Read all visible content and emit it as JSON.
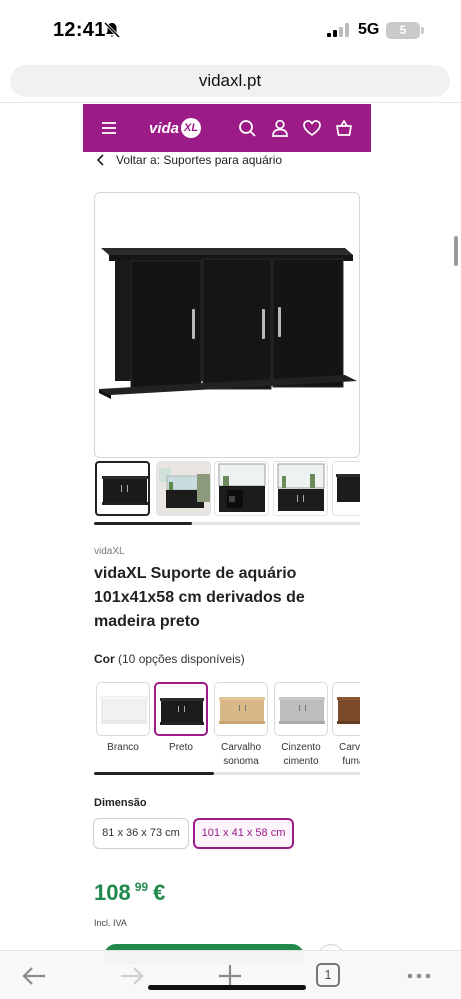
{
  "status_bar": {
    "time": "12:41",
    "network": "5G",
    "battery": "5"
  },
  "browser": {
    "url": "vidaxl.pt",
    "tab_count": "1"
  },
  "site_header": {
    "logo_text": "vida",
    "logo_badge": "XL",
    "background": "#9b1c86"
  },
  "breadcrumb": {
    "back_label": "Voltar a: Suportes para aquário"
  },
  "gallery": {
    "thumbnails": [
      "black-stand",
      "stand-with-aquarium-room",
      "stand-open-doors",
      "stand-with-aquarium",
      "stand-side"
    ],
    "scroll_progress": 0.37
  },
  "product": {
    "brand": "vidaXL",
    "title": "vidaXL Suporte de aquário 101x41x58 cm derivados de madeira preto"
  },
  "color": {
    "label": "Cor",
    "count_text": "(10 opções disponíveis)",
    "options": [
      {
        "name": "Branco",
        "swatch": "#f4f4f4"
      },
      {
        "name": "Preto",
        "swatch": "#1c1c1c"
      },
      {
        "name": "Carvalho sonoma",
        "swatch": "#d9b887"
      },
      {
        "name": "Cinzento cimento",
        "swatch": "#bdbdbd"
      },
      {
        "name": "Carvalho fumado",
        "swatch": "#7a4a2a"
      }
    ],
    "selected": "Preto",
    "scroll_progress": 0.45
  },
  "dimension": {
    "label": "Dimensão",
    "options": [
      "81 x 36 x 73 cm",
      "101 x 41 x 58 cm"
    ],
    "selected": "101 x 41 x 58 cm"
  },
  "price": {
    "integer": "108",
    "decimals": "99",
    "currency": "€",
    "vat_note": "Incl. IVA",
    "color": "#1f8a4c"
  },
  "accent_color": "#9b1c86"
}
